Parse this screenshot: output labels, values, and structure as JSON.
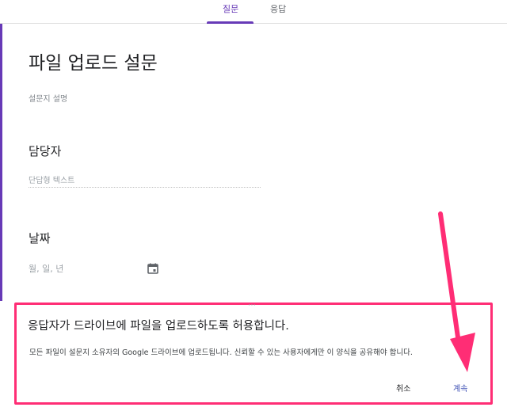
{
  "tabs": [
    {
      "label": "질문",
      "active": true
    },
    {
      "label": "응답",
      "active": false
    }
  ],
  "form": {
    "title": "파일 업로드 설문",
    "description_placeholder": "설문지 설명"
  },
  "questions": [
    {
      "title": "담당자",
      "input_placeholder": "단답형 텍스트"
    },
    {
      "title": "날짜",
      "input_placeholder": "월, 일, 년",
      "icon": "calendar-icon"
    }
  ],
  "dialog": {
    "title": "응답자가 드라이브에 파일을 업로드하도록 허용합니다.",
    "body": "모든 파일이 설문지 소유자의 Google 드라이브에 업로드됩니다. 신뢰할 수 있는 사용자에게만 이 양식을 공유해야 합니다.",
    "cancel_label": "취소",
    "continue_label": "계속"
  },
  "colors": {
    "accent": "#673ab7",
    "annotation": "#ff2d75",
    "button_primary": "#3f51b5"
  }
}
